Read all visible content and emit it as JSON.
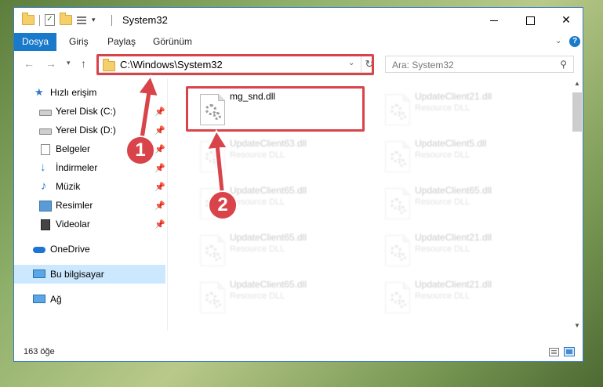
{
  "window": {
    "title": "System32"
  },
  "ribbon": {
    "tabs": [
      "Dosya",
      "Giriş",
      "Paylaş",
      "Görünüm"
    ]
  },
  "address": {
    "path": "C:\\Windows\\System32"
  },
  "search": {
    "placeholder": "Ara: System32"
  },
  "sidebar": {
    "items": [
      {
        "label": "Hızlı erişim",
        "icon": "star-icon"
      },
      {
        "label": "Yerel Disk (C:)",
        "icon": "drive-icon",
        "pinned": true
      },
      {
        "label": "Yerel Disk (D:)",
        "icon": "drive-icon",
        "pinned": true
      },
      {
        "label": "Belgeler",
        "icon": "document-icon",
        "pinned": true
      },
      {
        "label": "İndirmeler",
        "icon": "download-icon",
        "pinned": true
      },
      {
        "label": "Müzik",
        "icon": "music-icon",
        "pinned": true
      },
      {
        "label": "Resimler",
        "icon": "pictures-icon",
        "pinned": true
      },
      {
        "label": "Videolar",
        "icon": "video-icon",
        "pinned": true
      },
      {
        "label": "OneDrive",
        "icon": "cloud-icon"
      },
      {
        "label": "Bu bilgisayar",
        "icon": "computer-icon",
        "selected": true
      },
      {
        "label": "Ağ",
        "icon": "network-icon"
      }
    ]
  },
  "files": [
    {
      "name": "mg_snd.dll",
      "type": ""
    },
    {
      "name": "UpdateClient21.dll",
      "type": "Resource DLL"
    },
    {
      "name": "UpdateClient63.dll",
      "type": "Resource DLL"
    },
    {
      "name": "UpdateClient5.dll",
      "type": "Resource DLL"
    },
    {
      "name": "UpdateClient65.dll",
      "type": "Resource DLL"
    },
    {
      "name": "UpdateClient65.dll",
      "type": "Resource DLL"
    },
    {
      "name": "UpdateClient65.dll",
      "type": "Resource DLL"
    },
    {
      "name": "UpdateClient21.dll",
      "type": "Resource DLL"
    },
    {
      "name": "UpdateClient65.dll",
      "type": "Resource DLL"
    },
    {
      "name": "UpdateClient21.dll",
      "type": "Resource DLL"
    }
  ],
  "status": {
    "count": "163 öğe"
  },
  "annotations": {
    "step1": "1",
    "step2": "2",
    "color": "#d9434a"
  },
  "colors": {
    "accent": "#1979ca",
    "selection": "#cce8ff"
  }
}
